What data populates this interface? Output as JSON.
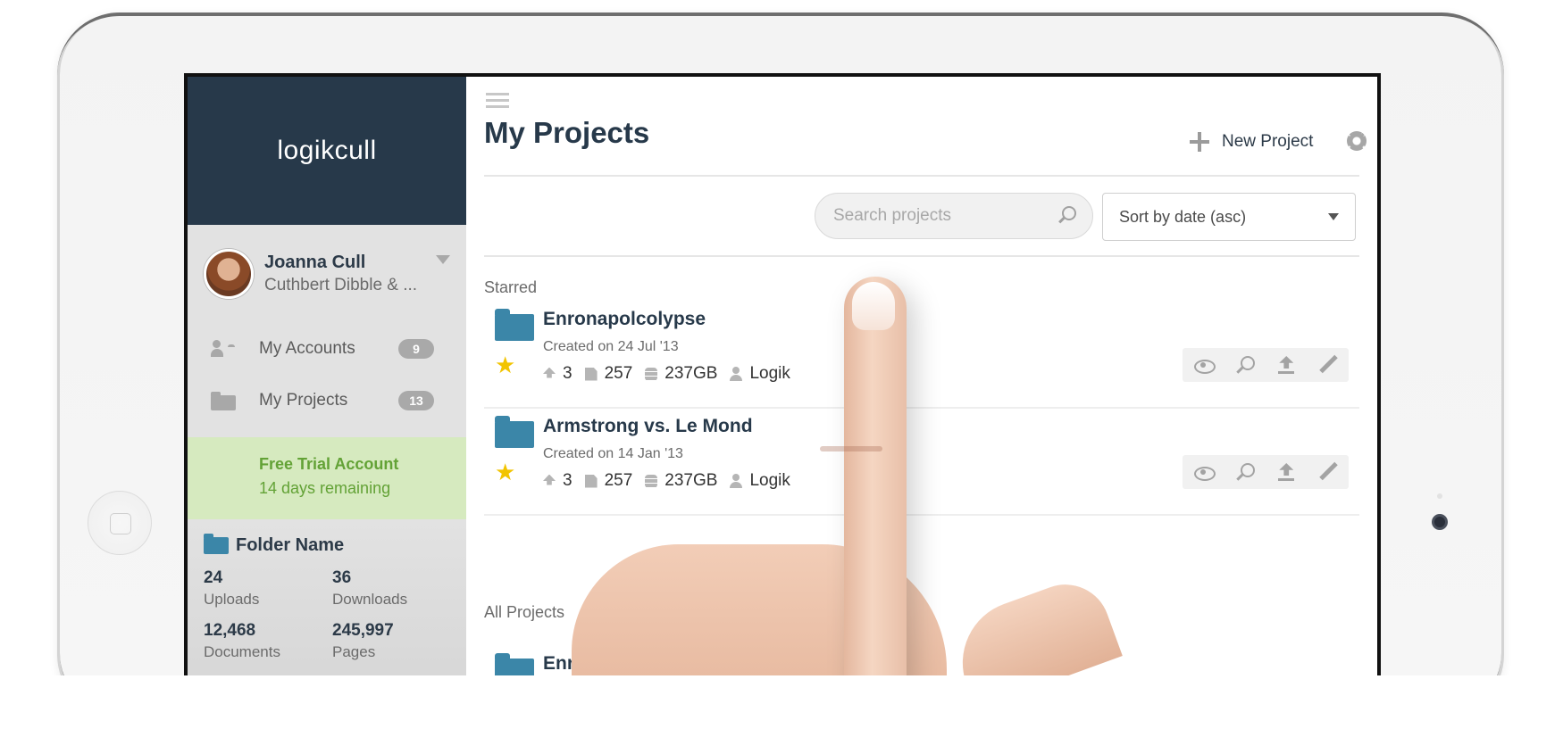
{
  "app": {
    "brand": "logikcull"
  },
  "user": {
    "name": "Joanna Cull",
    "organization": "Cuthbert Dibble & ..."
  },
  "sidebar": {
    "items": [
      {
        "label": "My Accounts",
        "badge": "9",
        "icon": "accounts-icon"
      },
      {
        "label": "My Projects",
        "badge": "13",
        "icon": "folder-icon"
      }
    ],
    "trial": {
      "title": "Free Trial Account",
      "days": "14 days remaining"
    },
    "folder": {
      "title": "Folder Name",
      "stats": [
        {
          "value": "24",
          "label": "Uploads"
        },
        {
          "value": "36",
          "label": "Downloads"
        },
        {
          "value": "12,468",
          "label": "Documents"
        },
        {
          "value": "245,997",
          "label": "Pages"
        }
      ]
    }
  },
  "header": {
    "title": "My Projects",
    "new_project_label": "New Project"
  },
  "search": {
    "placeholder": "Search projects",
    "value": ""
  },
  "sort": {
    "selected": "Sort by date (asc)"
  },
  "sections": {
    "starred": "Starred",
    "all": "All Projects"
  },
  "starred_projects": [
    {
      "name": "Enronapolcolypse",
      "created": "Created on 24 Jul '13",
      "uploads": "3",
      "documents": "257",
      "size": "237GB",
      "owner": "Logik"
    },
    {
      "name": "Armstrong vs. Le Mond",
      "created": "Created on 14 Jan '13",
      "uploads": "3",
      "documents": "257",
      "size": "237GB",
      "owner": "Logik"
    }
  ],
  "all_projects_partial": {
    "name": "Enr"
  },
  "colors": {
    "brand_dark": "#27394a",
    "folder_blue": "#3b86a8",
    "trial_green": "#63a236",
    "star": "#f2c400"
  }
}
